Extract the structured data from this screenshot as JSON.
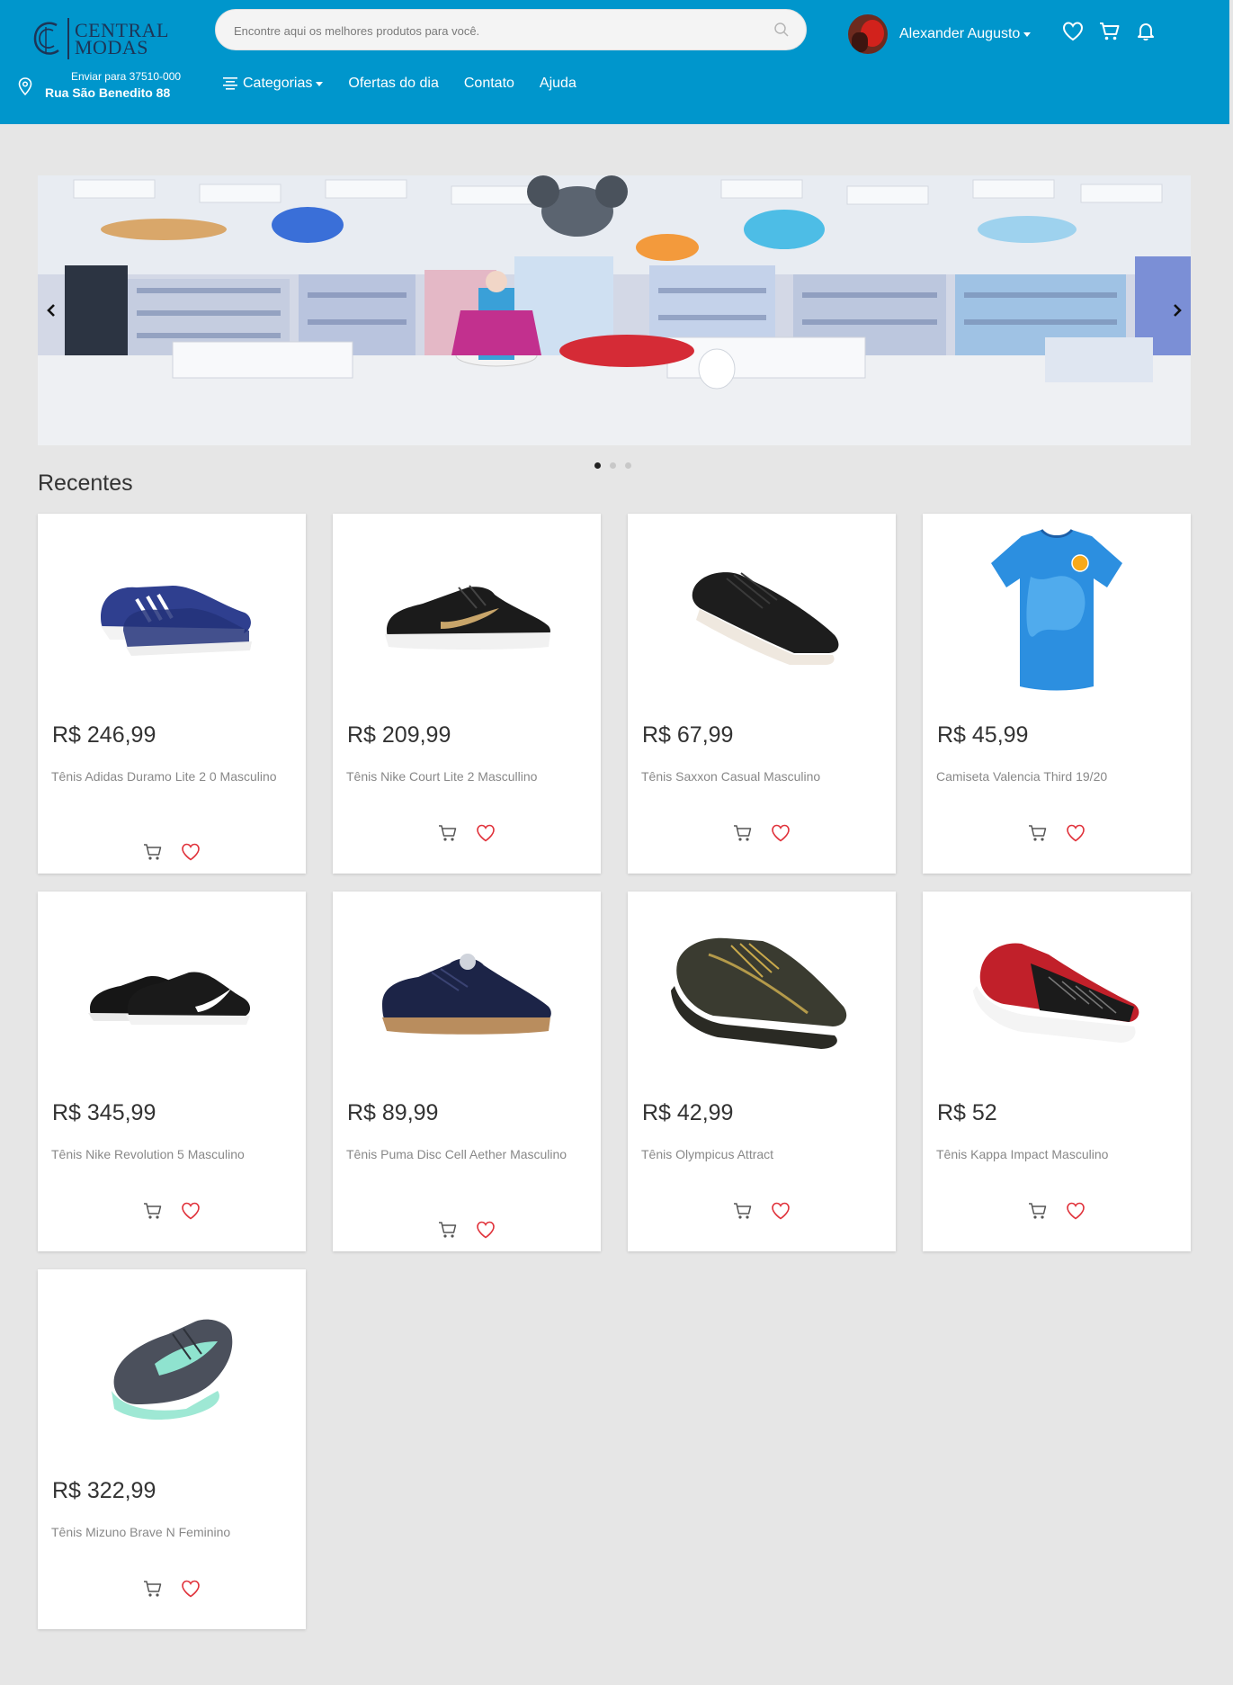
{
  "brand": {
    "line1": "CENTRAL",
    "line2": "MODAS"
  },
  "shipping": {
    "label": "Enviar para 37510-000",
    "address": "Rua São Benedito 88"
  },
  "search": {
    "placeholder": "Encontre aqui os melhores produtos para você."
  },
  "user": {
    "name": "Alexander Augusto"
  },
  "header_icons": [
    "heart-icon",
    "cart-icon",
    "bell-icon"
  ],
  "nav": [
    {
      "label": "Categorias"
    },
    {
      "label": "Ofertas do dia"
    },
    {
      "label": "Contato"
    },
    {
      "label": "Ajuda"
    }
  ],
  "carousel": {
    "slides": 3,
    "active_slide": 1
  },
  "section": {
    "title": "Recentes"
  },
  "products": [
    {
      "price": "R$ 246,99",
      "name": "Tênis Adidas Duramo Lite 2 0 Masculino",
      "image": "blue-sneaker"
    },
    {
      "price": "R$ 209,99",
      "name": "Tênis Nike Court Lite 2 Mascullino",
      "image": "black-gold-sneaker"
    },
    {
      "price": "R$ 67,99",
      "name": "Tênis Saxxon Casual Masculino",
      "image": "black-casual-sneaker"
    },
    {
      "price": "R$ 45,99",
      "name": "Camiseta Valencia Third 19/20",
      "image": "blue-jersey"
    },
    {
      "price": "R$ 345,99",
      "name": "Tênis Nike Revolution 5 Masculino",
      "image": "black-white-sneaker"
    },
    {
      "price": "R$ 89,99",
      "name": "Tênis Puma Disc Cell Aether Masculino",
      "image": "navy-sneaker"
    },
    {
      "price": "R$ 42,99",
      "name": "Tênis Olympicus Attract",
      "image": "olive-sneaker"
    },
    {
      "price": "R$ 52",
      "name": "Tênis Kappa Impact Masculino",
      "image": "red-black-sneaker"
    },
    {
      "price": "R$ 322,99",
      "name": "Tênis Mizuno Brave N Feminino",
      "image": "grey-mint-sneaker"
    }
  ],
  "colors": {
    "header": "#0096cc",
    "heart": "#e0313a",
    "background": "#e6e6e6"
  }
}
